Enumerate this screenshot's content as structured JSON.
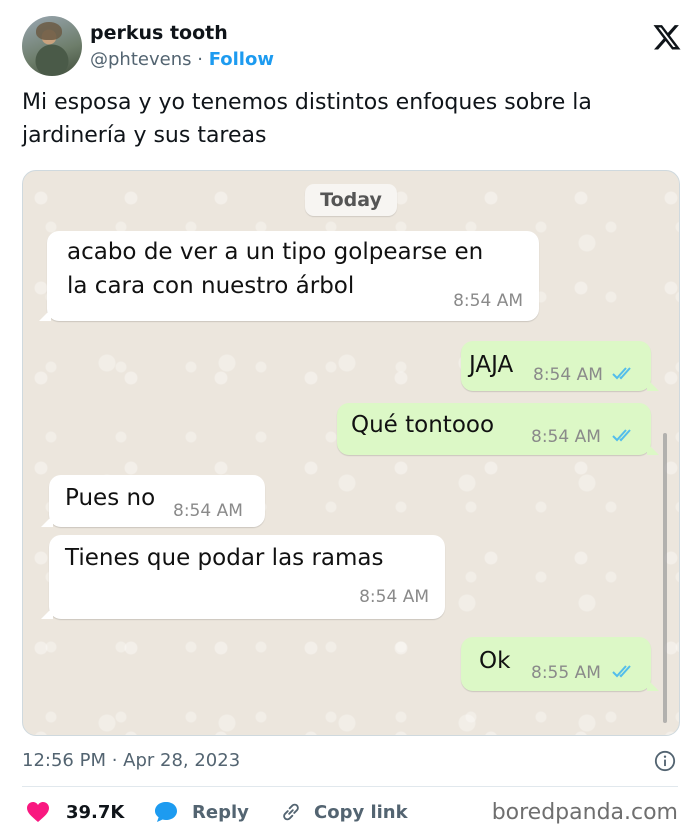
{
  "author": {
    "display_name": "perkus tooth",
    "handle": "@phtevens",
    "separator": "·",
    "follow_label": "Follow"
  },
  "tweet": {
    "text": "Mi esposa y yo tenemos distintos enfoques sobre la jardinería y sus tareas",
    "timestamp": "12:56 PM · Apr 28, 2023"
  },
  "chat": {
    "date_label": "Today",
    "messages": [
      {
        "direction": "in",
        "text_line1": "acabo de ver a un tipo golpearse en",
        "text_line2": "la cara con nuestro árbol",
        "time": "8:54 AM"
      },
      {
        "direction": "out",
        "text": "JAJA",
        "time": "8:54 AM",
        "read": true
      },
      {
        "direction": "out",
        "text": "Qué tontooo",
        "time": "8:54 AM",
        "read": true
      },
      {
        "direction": "in",
        "text": "Pues no",
        "time": "8:54 AM"
      },
      {
        "direction": "in",
        "text": "Tienes que podar las ramas",
        "time": "8:54 AM"
      },
      {
        "direction": "out",
        "text": "Ok",
        "time": "8:55 AM",
        "read": true
      }
    ]
  },
  "actions": {
    "likes": "39.7K",
    "reply_label": "Reply",
    "copy_link_label": "Copy link"
  },
  "watermark": "boredpanda.com",
  "colors": {
    "accent": "#1d9bf0",
    "like": "#f91880",
    "incoming_bubble": "#ffffff",
    "outgoing_bubble": "#dcf8c6",
    "read_ticks": "#53bdeb"
  }
}
